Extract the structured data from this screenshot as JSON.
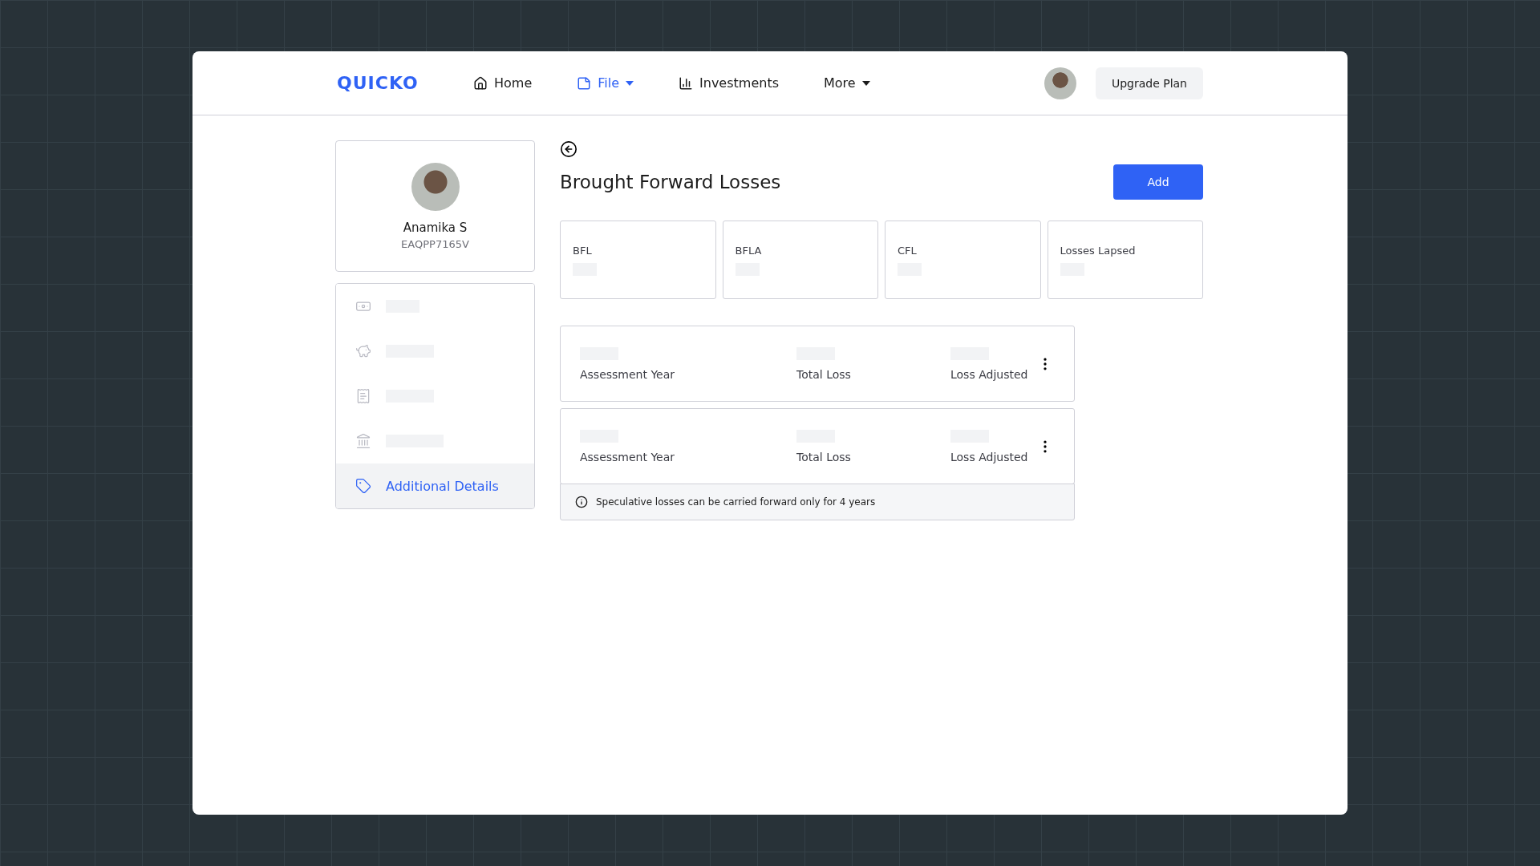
{
  "header": {
    "logo": "QUICKO",
    "nav": [
      {
        "label": "Home",
        "dropdown": false,
        "selected": false
      },
      {
        "label": "File",
        "dropdown": true,
        "selected": true
      },
      {
        "label": "Investments",
        "dropdown": false,
        "selected": false
      },
      {
        "label": "More",
        "dropdown": true,
        "selected": false
      }
    ],
    "upgrade_button": "Upgrade Plan"
  },
  "profile": {
    "name": "Anamika S",
    "pan": "EAQPP7165V"
  },
  "sidebar": {
    "items": [
      {
        "kind": "loading",
        "selected": false
      },
      {
        "kind": "loading",
        "selected": false
      },
      {
        "kind": "loading",
        "selected": false
      },
      {
        "kind": "loading",
        "selected": false
      },
      {
        "kind": "item",
        "label": "Additional Details",
        "selected": true
      }
    ]
  },
  "page": {
    "title": "Brought Forward Losses",
    "add_button": "Add",
    "summary": [
      {
        "label": "BFL"
      },
      {
        "label": "BFLA"
      },
      {
        "label": "CFL"
      },
      {
        "label": "Losses Lapsed"
      }
    ],
    "entries": [
      {
        "fields": [
          "Assessment Year",
          "Total Loss",
          "Loss Adjusted"
        ]
      },
      {
        "fields": [
          "Assessment Year",
          "Total Loss",
          "Loss Adjusted"
        ]
      }
    ],
    "note": "Speculative losses can be carried forward only for 4 years"
  }
}
